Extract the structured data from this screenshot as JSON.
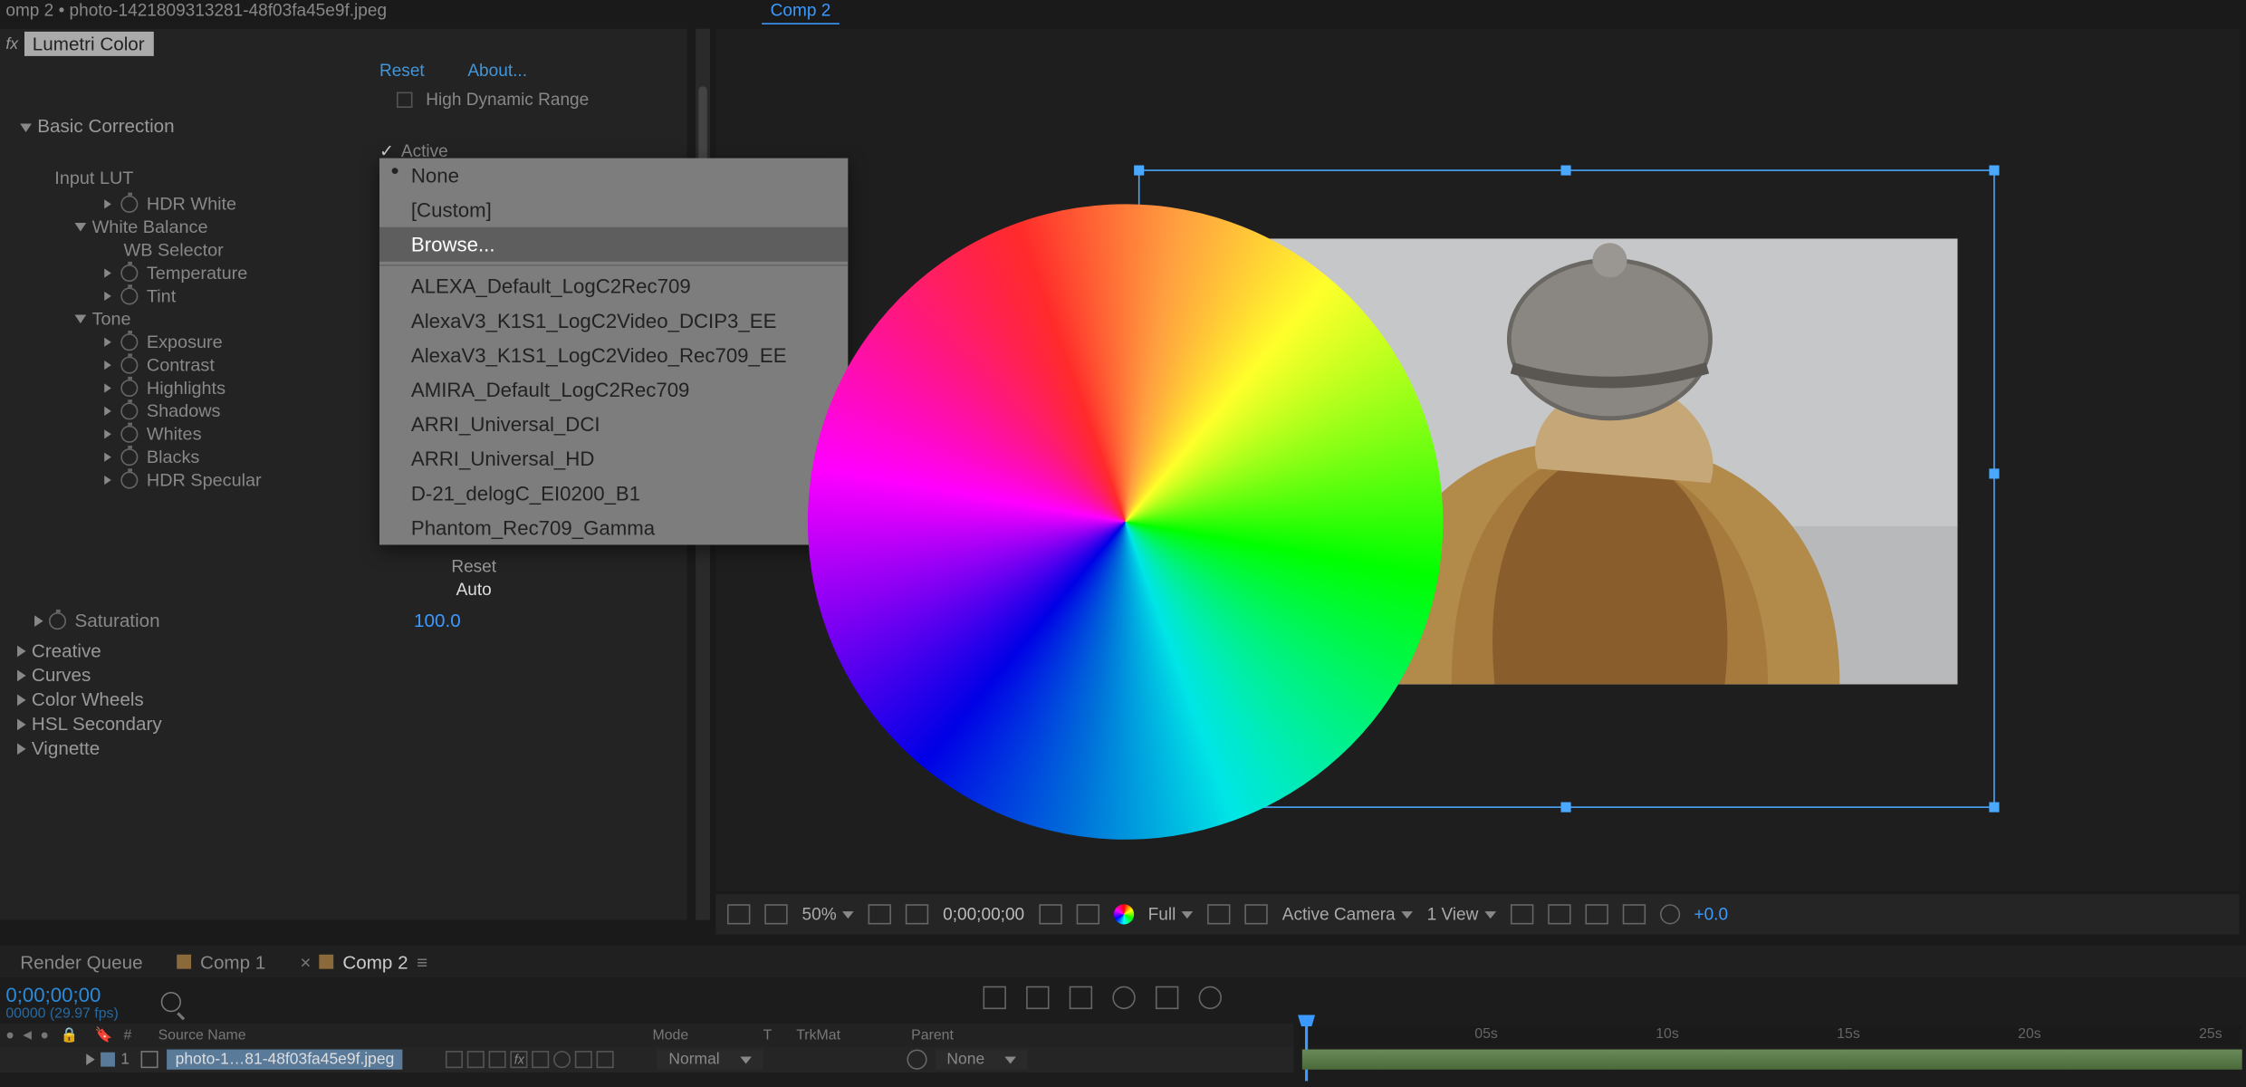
{
  "window": {
    "title": "omp 2 • photo-1421809313281-48f03fa45e9f.jpeg"
  },
  "preview_tab": "Comp 2",
  "effect": {
    "name": "Lumetri Color",
    "reset": "Reset",
    "about": "About...",
    "hdr_label": "High Dynamic Range",
    "active_label": "Active"
  },
  "basic": {
    "header": "Basic Correction",
    "input_lut_label": "Input LUT",
    "input_lut_value": "None",
    "hdr_white": "HDR White",
    "white_balance": "White Balance",
    "wb_selector": "WB Selector",
    "temperature": "Temperature",
    "tint": "Tint",
    "tone": "Tone",
    "exposure": "Exposure",
    "contrast": "Contrast",
    "highlights": "Highlights",
    "shadows": "Shadows",
    "whites": "Whites",
    "blacks": "Blacks",
    "hdr_specular": "HDR Specular",
    "reset_btn": "Reset",
    "auto_btn": "Auto",
    "saturation": "Saturation",
    "saturation_val": "100.0"
  },
  "sections": {
    "creative": "Creative",
    "curves": "Curves",
    "color_wheels": "Color Wheels",
    "hsl": "HSL Secondary",
    "vignette": "Vignette"
  },
  "lut_popup": {
    "none": "None",
    "custom": "[Custom]",
    "browse": "Browse...",
    "items": [
      "ALEXA_Default_LogC2Rec709",
      "AlexaV3_K1S1_LogC2Video_DCIP3_EE",
      "AlexaV3_K1S1_LogC2Video_Rec709_EE",
      "AMIRA_Default_LogC2Rec709",
      "ARRI_Universal_DCI",
      "ARRI_Universal_HD",
      "D-21_delogC_EI0200_B1",
      "Phantom_Rec709_Gamma"
    ]
  },
  "preview_bar": {
    "zoom": "50%",
    "timecode": "0;00;00;00",
    "res": "Full",
    "camera": "Active Camera",
    "views": "1 View",
    "exposure": "+0.0"
  },
  "bottom_tabs": {
    "render_queue": "Render Queue",
    "comp1": "Comp 1",
    "comp2": "Comp 2"
  },
  "timeline": {
    "current_time": "0;00;00;00",
    "frame_info": "00000 (29.97 fps)",
    "col_num": "#",
    "col_source": "Source Name",
    "col_mode": "Mode",
    "col_t": "T",
    "col_trkmat": "TrkMat",
    "col_parent": "Parent",
    "layer_num": "1",
    "layer_name": "photo-1…81-48f03fa45e9f.jpeg",
    "mode_val": "Normal",
    "parent_val": "None",
    "ticks": [
      "05s",
      "10s",
      "15s",
      "20s",
      "25s"
    ]
  }
}
